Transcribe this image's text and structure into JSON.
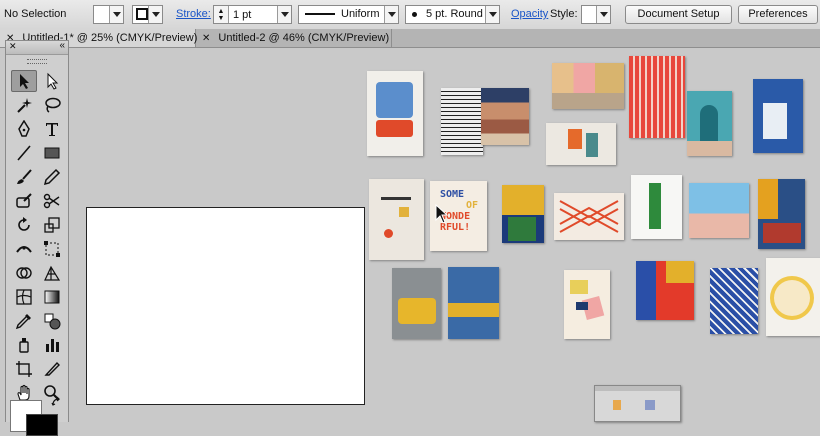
{
  "control_bar": {
    "selection_label": "No Selection",
    "stroke_label": "Stroke:",
    "stroke_weight": "1 pt",
    "stroke_profile": "Uniform",
    "brush_definition": "5 pt. Round",
    "opacity_label": "Opacity",
    "style_label": "Style:",
    "document_setup_button": "Document Setup",
    "preferences_button": "Preferences"
  },
  "tabs": [
    {
      "label": "Untitled-1* @ 25% (CMYK/Preview)",
      "close": "✕"
    },
    {
      "label": "Untitled-2 @ 46% (CMYK/Preview)",
      "close": "✕"
    }
  ],
  "tools_panel": {
    "close_glyph": "✕",
    "collapse_glyph": "«",
    "tools": [
      "selection-tool",
      "direct-selection-tool",
      "magic-wand-tool",
      "lasso-tool",
      "pen-tool",
      "type-tool",
      "line-segment-tool",
      "rectangle-tool",
      "paintbrush-tool",
      "pencil-tool",
      "blob-brush-tool",
      "scissors-tool",
      "rotate-tool",
      "scale-tool",
      "width-tool",
      "free-transform-tool",
      "shape-builder-tool",
      "perspective-grid-tool",
      "mesh-tool",
      "gradient-tool",
      "eyedropper-tool",
      "blend-tool",
      "symbol-sprayer-tool",
      "column-graph-tool",
      "artboard-tool",
      "slice-tool",
      "hand-tool",
      "zoom-tool"
    ]
  },
  "poster_text": {
    "line1": "SOME",
    "line2": "OF",
    "line3": "WONDE",
    "line4": "RFUL!"
  },
  "colors": {
    "canvas": "#c9c9c9",
    "accent_link": "#1a55c8",
    "poster_red": "#e04a2a",
    "poster_blue": "#5b8ecc"
  }
}
